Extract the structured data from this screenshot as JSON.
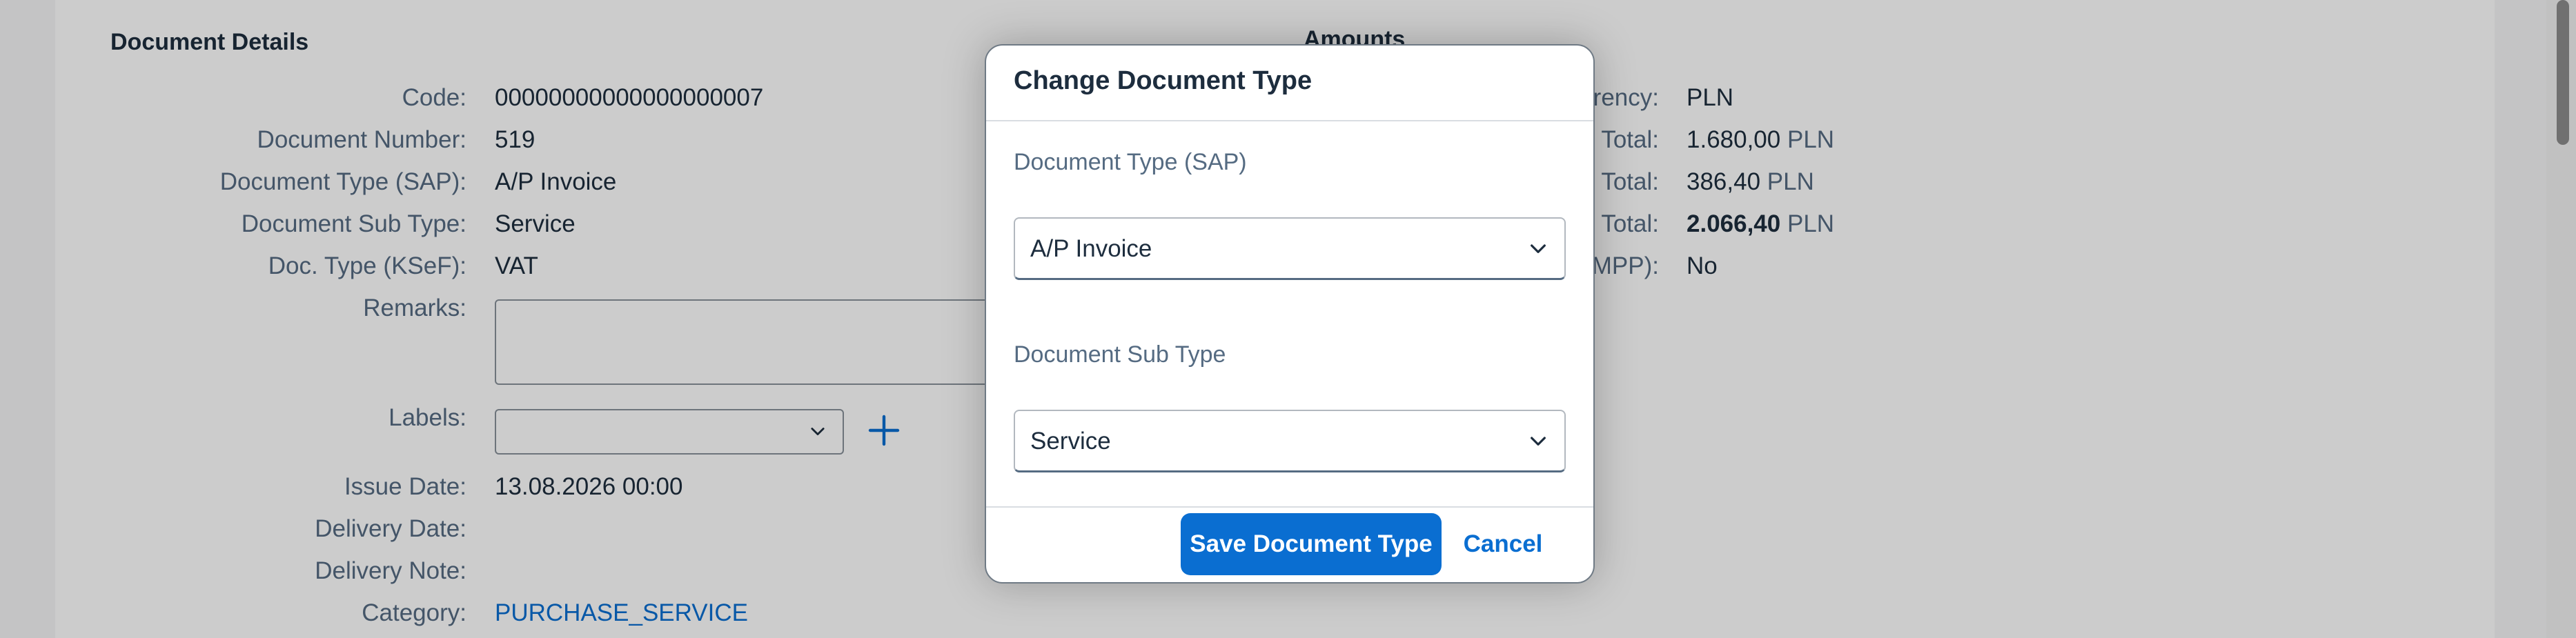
{
  "details": {
    "title": "Document Details",
    "rows": [
      {
        "label": "Code:",
        "value": "00000000000000000007"
      },
      {
        "label": "Document Number:",
        "value": "519"
      },
      {
        "label": "Document Type (SAP):",
        "value": "A/P Invoice"
      },
      {
        "label": "Document Sub Type:",
        "value": "Service"
      },
      {
        "label": "Doc. Type (KSeF):",
        "value": "VAT"
      },
      {
        "label": "Remarks:",
        "value": ""
      },
      {
        "label": "Labels:",
        "value": ""
      },
      {
        "label": "Issue Date:",
        "value": "13.08.2026 00:00"
      },
      {
        "label": "Delivery Date:",
        "value": ""
      },
      {
        "label": "Delivery Note:",
        "value": ""
      },
      {
        "label": "Category:",
        "value": "PURCHASE_SERVICE"
      }
    ]
  },
  "amounts": {
    "title": "Amounts",
    "rows": [
      {
        "label": "rrency:",
        "value": "PLN",
        "unit": ""
      },
      {
        "label": "Total:",
        "value": "1.680,00",
        "unit": "PLN"
      },
      {
        "label": "Total:",
        "value": "386,40",
        "unit": "PLN"
      },
      {
        "label": "s Total:",
        "value": "2.066,40",
        "unit": "PLN"
      },
      {
        "label": "MPP):",
        "value": "No",
        "unit": ""
      }
    ]
  },
  "dialog": {
    "title": "Change Document Type",
    "doc_type_label": "Document Type (SAP)",
    "doc_type_value": "A/P Invoice",
    "sub_type_label": "Document Sub Type",
    "sub_type_value": "Service",
    "save_label": "Save Document Type",
    "cancel_label": "Cancel"
  },
  "icons": {
    "dropdown": "chevron-down-icon",
    "add": "plus-icon"
  },
  "colors": {
    "accent": "#0a6ed1",
    "label": "#556b82",
    "text": "#1d2d3e"
  }
}
